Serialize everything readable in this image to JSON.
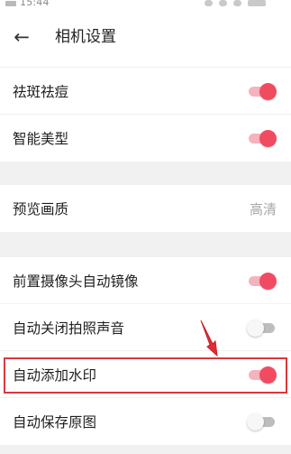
{
  "status_bar": {
    "time": "15:44"
  },
  "header": {
    "title": "相机设置"
  },
  "groups": [
    {
      "items": [
        {
          "label": "祛斑祛痘",
          "toggle": "on"
        },
        {
          "label": "智能美型",
          "toggle": "on"
        }
      ]
    },
    {
      "items": [
        {
          "label": "预览画质",
          "value": "高清"
        }
      ]
    },
    {
      "items": [
        {
          "label": "前置摄像头自动镜像",
          "toggle": "on"
        },
        {
          "label": "自动关闭拍照声音",
          "toggle": "off"
        },
        {
          "label": "自动添加水印",
          "toggle": "on"
        },
        {
          "label": "自动保存原图",
          "toggle": "off"
        }
      ]
    }
  ],
  "colors": {
    "accent": "#f14b62",
    "highlight": "#d9383c",
    "background": "#f1f1f1"
  },
  "icons": {
    "back": "arrow-left-icon"
  }
}
